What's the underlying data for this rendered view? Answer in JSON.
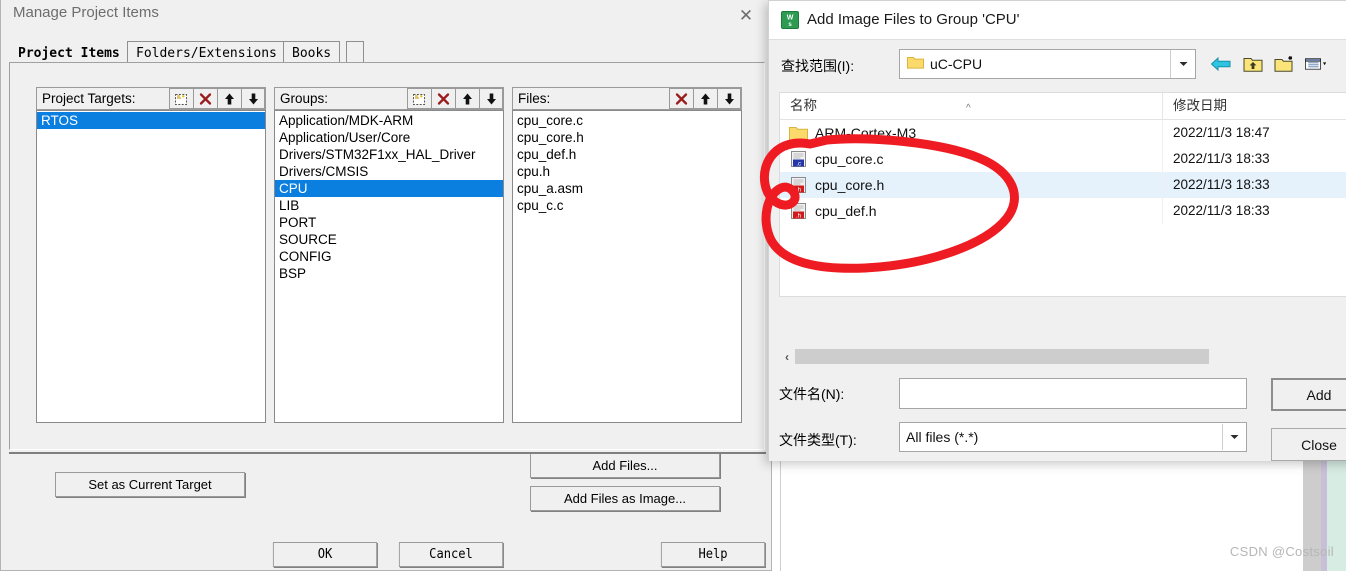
{
  "main_dialog": {
    "title": "Manage Project Items",
    "close_icon": "✕",
    "tabs": [
      {
        "label": "Project Items",
        "active": true
      },
      {
        "label": "Folders/Extensions",
        "active": false
      },
      {
        "label": "Books",
        "active": false
      }
    ],
    "project_targets": {
      "header": "Project Targets:",
      "toolbar": [
        "new-item-icon",
        "delete-icon",
        "move-up-icon",
        "move-down-icon"
      ],
      "items": [
        {
          "label": "RTOS",
          "selected": true
        }
      ]
    },
    "groups": {
      "header": "Groups:",
      "toolbar": [
        "new-item-icon",
        "delete-icon",
        "move-up-icon",
        "move-down-icon"
      ],
      "items": [
        {
          "label": "Application/MDK-ARM",
          "selected": false
        },
        {
          "label": "Application/User/Core",
          "selected": false
        },
        {
          "label": "Drivers/STM32F1xx_HAL_Driver",
          "selected": false
        },
        {
          "label": "Drivers/CMSIS",
          "selected": false
        },
        {
          "label": "CPU",
          "selected": true
        },
        {
          "label": "LIB",
          "selected": false
        },
        {
          "label": "PORT",
          "selected": false
        },
        {
          "label": "SOURCE",
          "selected": false
        },
        {
          "label": "CONFIG",
          "selected": false
        },
        {
          "label": "BSP",
          "selected": false
        }
      ]
    },
    "files": {
      "header": "Files:",
      "toolbar": [
        "delete-icon",
        "move-up-icon",
        "move-down-icon"
      ],
      "items": [
        {
          "label": "cpu_core.c",
          "selected": false
        },
        {
          "label": "cpu_core.h",
          "selected": false
        },
        {
          "label": "cpu_def.h",
          "selected": false
        },
        {
          "label": "cpu.h",
          "selected": false
        },
        {
          "label": "cpu_a.asm",
          "selected": false
        },
        {
          "label": "cpu_c.c",
          "selected": false
        }
      ]
    },
    "buttons": {
      "set_as_current_target": "Set as Current Target",
      "add_files": "Add Files...",
      "add_files_as_image": "Add Files as Image...",
      "ok": "OK",
      "cancel": "Cancel",
      "help": "Help"
    }
  },
  "file_dialog": {
    "title": "Add Image Files to Group 'CPU'",
    "app_icon": "keil-uvision-icon",
    "look_in": {
      "label": "查找范围(I):",
      "value": "uC-CPU",
      "folder_icon": "folder-icon",
      "dropdown_icon": "chevron-down-icon"
    },
    "toolbar": [
      {
        "icon": "back-arrow-icon"
      },
      {
        "icon": "up-folder-icon"
      },
      {
        "icon": "new-folder-icon"
      },
      {
        "icon": "views-icon"
      }
    ],
    "list": {
      "columns": [
        "名称",
        "修改日期"
      ],
      "sort_indicator": "^",
      "rows": [
        {
          "name": "ARM-Cortex-M3",
          "date": "2022/11/3 18:47",
          "icon": "folder-icon",
          "selected": false
        },
        {
          "name": "cpu_core.c",
          "date": "2022/11/3 18:33",
          "icon": "c-file-icon",
          "selected": false
        },
        {
          "name": "cpu_core.h",
          "date": "2022/11/3 18:33",
          "icon": "h-file-icon",
          "selected": true
        },
        {
          "name": "cpu_def.h",
          "date": "2022/11/3 18:33",
          "icon": "h-file-icon",
          "selected": false
        }
      ]
    },
    "hscroll": {
      "left_arrow": "‹"
    },
    "file_name": {
      "label": "文件名(N):",
      "value": "",
      "placeholder": ""
    },
    "file_type": {
      "label": "文件类型(T):",
      "value": "All files (*.*)",
      "dropdown_icon": "chevron-down-icon"
    },
    "buttons": {
      "add": "Add",
      "close": "Close"
    }
  },
  "annotation": {
    "shape": "hand-drawn-red-ellipse",
    "color": "#ee1c22"
  },
  "watermark": "CSDN @Costsoil",
  "colors": {
    "selection_blue": "#0a7fe0",
    "list_hover_blue": "#e5f1fb",
    "dialog_face": "#f0f0f0",
    "annotation_red": "#ee1c22"
  }
}
